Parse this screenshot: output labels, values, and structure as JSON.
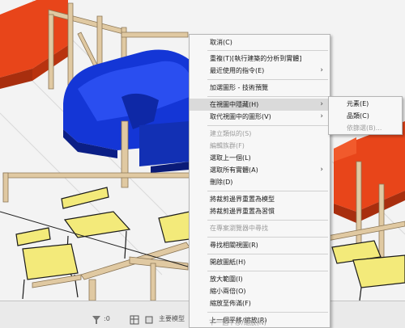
{
  "context_menu": {
    "cancel": "取消(C)",
    "repeat": "重複(T)[執行建築的分析到實體]",
    "recent": "最近使用的指令(E)",
    "add_graphics": "加選圖形 - 技術預覽",
    "hide_in_view": "在視圖中隱藏(H)",
    "override_graphics": "取代視圖中的圖形(V)",
    "create_similar": "建立類似的(S)",
    "edit_family": "編輯族群(F)",
    "select_previous": "選取上一個(L)",
    "select_all_instances": "選取所有實體(A)",
    "delete": "刪除(D)",
    "section_box_model": "將裁剪邊界重置為模型",
    "section_box_sheet": "將裁剪邊界重置為習慣",
    "browser_find": "在專案瀏覽器中尋找",
    "find_referring": "尋找相關視圖(R)",
    "open_sheet": "開啟圖紙(H)",
    "zoom_in": "放大範圍(I)",
    "zoom_out": "縮小兩倍(O)",
    "zoom_fit": "縮放至佈滿(F)",
    "prev_pan": "上一個平移/縮放(R)",
    "next_pan": "下一個平移/縮放(N)"
  },
  "submenu": {
    "elements": "元素(E)",
    "category": "品類(C)",
    "by_filter": "依篩選(B)..."
  },
  "status_bar": {
    "scale_value": ":0",
    "model_label": "主要模型"
  },
  "colors": {
    "menu_bg": "#f7f7f7",
    "highlight": "#dadada",
    "disabled_text": "#9c9c9c",
    "sofa_blue": "#1436d6",
    "sofa_red": "#e8451a",
    "chair_yellow": "#f3ea7a",
    "timber": "#e0c9a2"
  }
}
